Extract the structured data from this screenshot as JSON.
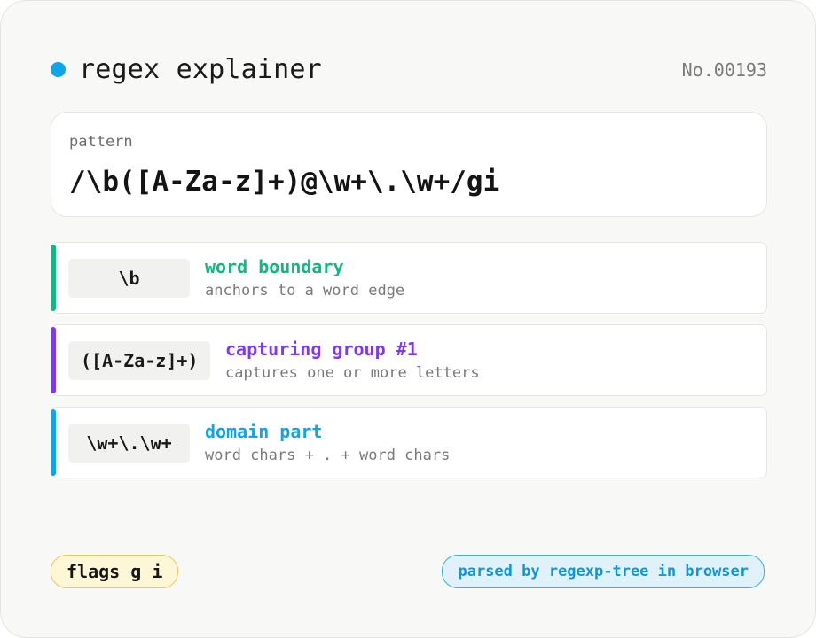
{
  "app": {
    "title": "regex explainer",
    "serial": "No.00193",
    "accent": "#0ea5e9"
  },
  "pattern": {
    "label": "pattern",
    "value": "/\\b([A-Za-z]+)@\\w+\\.\\w+/gi"
  },
  "tokens": [
    {
      "token": "\\b",
      "name": "word boundary",
      "description": "anchors to a word edge",
      "color": "#10b981"
    },
    {
      "token": "([A-Za-z]+)",
      "name": "capturing group #1",
      "description": "captures one or more letters",
      "color": "#7c3aed"
    },
    {
      "token": "\\w+\\.\\w+",
      "name": "domain part",
      "description": "word chars + . + word chars",
      "color": "#0ea5e9"
    }
  ],
  "footer": {
    "flags_label": "flags g i",
    "parser_note": "parsed by regexp-tree in browser"
  }
}
